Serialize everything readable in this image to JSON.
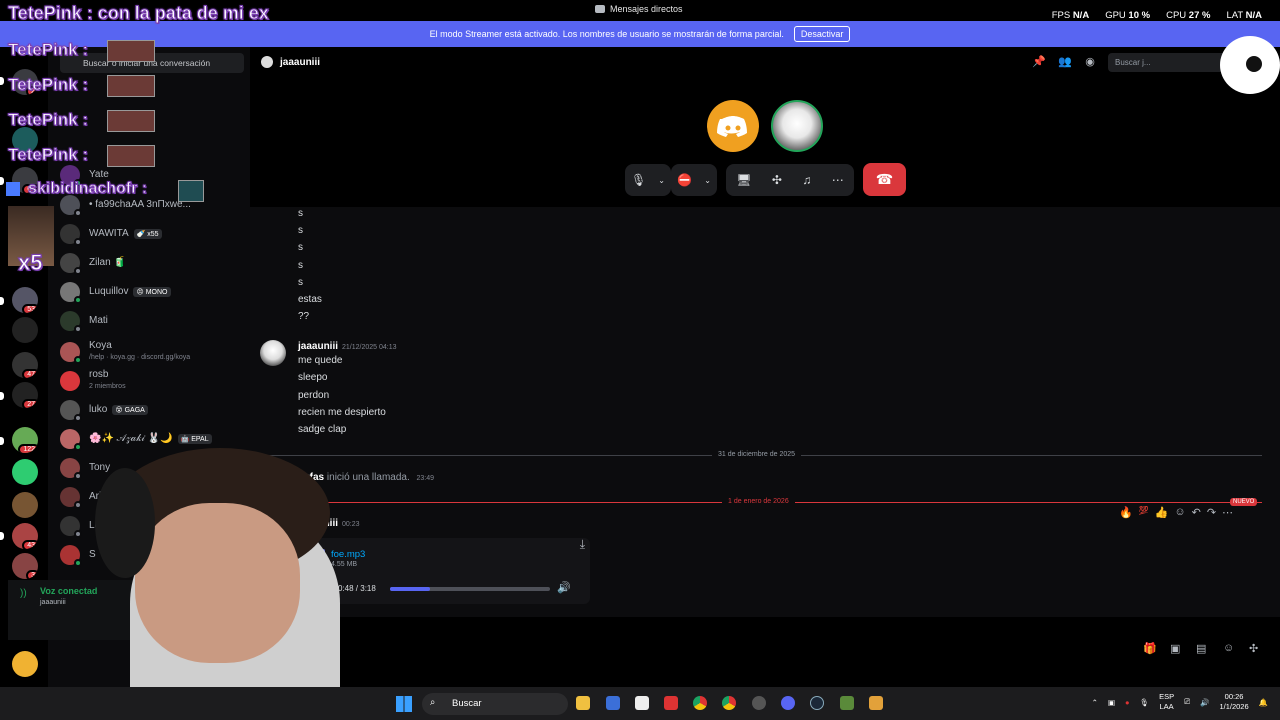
{
  "overlay": {
    "headline": "TetePink : con la pata de mi ex",
    "chat_user": "TetePink :",
    "chat_user2": "skibidinachofr :",
    "x5": "x5"
  },
  "titlebar": {
    "title": "Mensajes directos",
    "fps_label": "FPS",
    "fps_value": "N/A",
    "gpu_label": "GPU",
    "gpu_value": "10 %",
    "cpu_label": "CPU",
    "cpu_value": "27 %",
    "lat_label": "LAT",
    "lat_value": "N/A"
  },
  "banner": {
    "text": "El modo Streamer está activado. Los nombres de usuario se mostrarán de forma parcial.",
    "button": "Desactivar"
  },
  "rail": {
    "badges": [
      "2",
      "67",
      "53",
      "47",
      "27",
      "122",
      "43",
      "3"
    ]
  },
  "dmlist": {
    "search_placeholder": "Buscar o iniciar una conversación",
    "items": [
      {
        "name": "Yate"
      },
      {
        "name": "• fa99chaAA 3nΠxwe..."
      },
      {
        "name": "WAWITA",
        "tag": "🍼 x55"
      },
      {
        "name": "Zilan 🧃"
      },
      {
        "name": "Luquillov",
        "tag": "😠 MONO"
      },
      {
        "name": "Mati"
      },
      {
        "name": "Koya",
        "sub": "/help · koya.gg · discord.gg/koya"
      },
      {
        "name": "rosb",
        "sub": "2 miembros"
      },
      {
        "name": "luko",
        "tag": "😵 GAGA"
      },
      {
        "name": "🌸✨ 𝒜𝓏𝒶𝓀𝒾 🐰🌙",
        "tag": "🤖 EPAL"
      },
      {
        "name": "Tony"
      },
      {
        "name": "Aria"
      },
      {
        "name": "Lu"
      },
      {
        "name": "S"
      }
    ],
    "voice_title": "Voz conectad",
    "voice_sub": "jaaauniii"
  },
  "channel": {
    "name": "jaaauniii",
    "search_placeholder": "Buscar j..."
  },
  "messages": {
    "early_lines": [
      "s",
      "s",
      "s",
      "s",
      "s",
      "estas",
      "??"
    ],
    "group1_author": "jaaauniii",
    "group1_time": "21/12/2025 04:13",
    "group1_lines": [
      "me quede",
      "sleepo",
      "perdon",
      "recien me despierto",
      "sadge clap"
    ],
    "divider1": "31 de diciembre de 2025",
    "call_author": "cufas",
    "call_text": "inició una llamada.",
    "call_time": "23:49",
    "divider2": "1 de enero de 2026",
    "new_label": "NUEVO",
    "group2_author": "jaaauniii",
    "group2_time": "00:23",
    "file_name": "foe.mp3",
    "file_size": "4.55 MB",
    "file_time": "0:48 / 3:18",
    "progress": 0.25
  },
  "taskbar": {
    "search": "Buscar",
    "lang1": "ESP",
    "lang2": "LAA",
    "time": "00:26",
    "date": "1/1/2026"
  },
  "colors": {
    "blurple": "#5865f2",
    "red": "#da373c",
    "green": "#23a55a",
    "link": "#00a8fc",
    "overlay_outline": "#7b3fb3"
  }
}
